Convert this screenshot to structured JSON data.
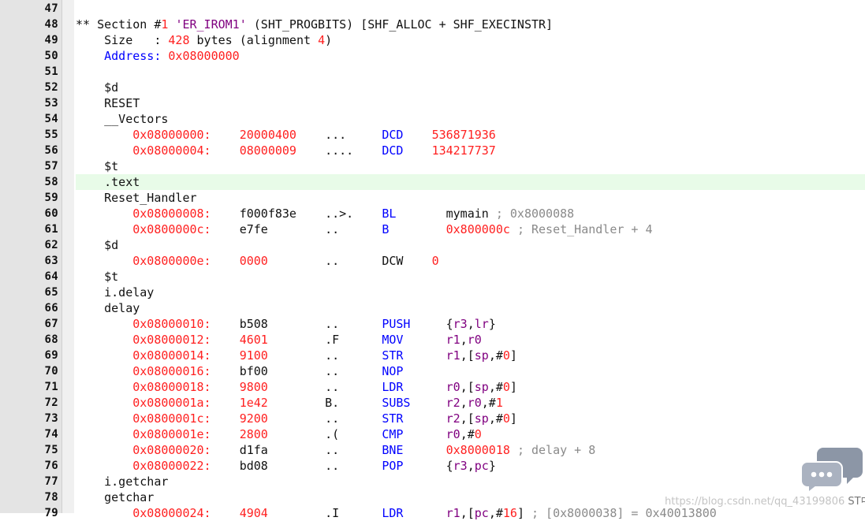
{
  "editor": {
    "lines": [
      {
        "n": "47",
        "t": [
          [
            "",
            "d"
          ]
        ]
      },
      {
        "n": "48",
        "t": [
          [
            "** Section #",
            "d"
          ],
          [
            "1",
            "n"
          ],
          [
            " ",
            "d"
          ],
          [
            "'ER_IROM1'",
            "s"
          ],
          [
            " (SHT_PROGBITS) [SHF_ALLOC + SHF_EXECINSTR]",
            "d"
          ]
        ]
      },
      {
        "n": "49",
        "t": [
          [
            "    Size   : ",
            "d"
          ],
          [
            "428",
            "n"
          ],
          [
            " bytes (alignment ",
            "d"
          ],
          [
            "4",
            "n"
          ],
          [
            ")",
            "d"
          ]
        ]
      },
      {
        "n": "50",
        "t": [
          [
            "    ",
            "d"
          ],
          [
            "Address:",
            "k"
          ],
          [
            " ",
            "d"
          ],
          [
            "0x08000000",
            "n"
          ]
        ]
      },
      {
        "n": "51",
        "t": [
          [
            "",
            "d"
          ]
        ]
      },
      {
        "n": "52",
        "t": [
          [
            "    $d",
            "d"
          ]
        ]
      },
      {
        "n": "53",
        "t": [
          [
            "    RESET",
            "d"
          ]
        ]
      },
      {
        "n": "54",
        "t": [
          [
            "    __Vectors",
            "d"
          ]
        ]
      },
      {
        "n": "55",
        "t": [
          [
            "        ",
            "d"
          ],
          [
            "0x08000000:",
            "n"
          ],
          [
            "    ",
            "d"
          ],
          [
            "20000400",
            "n"
          ],
          [
            "    ...     ",
            "d"
          ],
          [
            "DCD",
            "k"
          ],
          [
            "    ",
            "d"
          ],
          [
            "536871936",
            "n"
          ]
        ]
      },
      {
        "n": "56",
        "t": [
          [
            "        ",
            "d"
          ],
          [
            "0x08000004:",
            "n"
          ],
          [
            "    ",
            "d"
          ],
          [
            "08000009",
            "n"
          ],
          [
            "    ....    ",
            "d"
          ],
          [
            "DCD",
            "k"
          ],
          [
            "    ",
            "d"
          ],
          [
            "134217737",
            "n"
          ]
        ]
      },
      {
        "n": "57",
        "t": [
          [
            "    $t",
            "d"
          ]
        ]
      },
      {
        "n": "58",
        "t": [
          [
            "    .text",
            "d"
          ]
        ],
        "hl": true
      },
      {
        "n": "59",
        "t": [
          [
            "    Reset_Handler",
            "d"
          ]
        ]
      },
      {
        "n": "60",
        "t": [
          [
            "        ",
            "d"
          ],
          [
            "0x08000008:",
            "n"
          ],
          [
            "    f000f83e    ..>.    ",
            "d"
          ],
          [
            "BL",
            "k"
          ],
          [
            "       mymain ",
            "d"
          ],
          [
            "; 0x8000088",
            "g"
          ]
        ]
      },
      {
        "n": "61",
        "t": [
          [
            "        ",
            "d"
          ],
          [
            "0x0800000c:",
            "n"
          ],
          [
            "    e7fe        ..      ",
            "d"
          ],
          [
            "B",
            "k"
          ],
          [
            "        ",
            "d"
          ],
          [
            "0x800000c",
            "n"
          ],
          [
            " ",
            "d"
          ],
          [
            "; Reset_Handler + 4",
            "g"
          ]
        ]
      },
      {
        "n": "62",
        "t": [
          [
            "    $d",
            "d"
          ]
        ]
      },
      {
        "n": "63",
        "t": [
          [
            "        ",
            "d"
          ],
          [
            "0x0800000e:",
            "n"
          ],
          [
            "    ",
            "d"
          ],
          [
            "0000",
            "n"
          ],
          [
            "        ..      DCW    ",
            "d"
          ],
          [
            "0",
            "n"
          ]
        ]
      },
      {
        "n": "64",
        "t": [
          [
            "    $t",
            "d"
          ]
        ]
      },
      {
        "n": "65",
        "t": [
          [
            "    i.delay",
            "d"
          ]
        ]
      },
      {
        "n": "66",
        "t": [
          [
            "    delay",
            "d"
          ]
        ]
      },
      {
        "n": "67",
        "t": [
          [
            "        ",
            "d"
          ],
          [
            "0x08000010:",
            "n"
          ],
          [
            "    b508        ..      ",
            "d"
          ],
          [
            "PUSH",
            "k"
          ],
          [
            "     {",
            "d"
          ],
          [
            "r3",
            "s"
          ],
          [
            ",",
            "d"
          ],
          [
            "lr",
            "s"
          ],
          [
            "}",
            "d"
          ]
        ]
      },
      {
        "n": "68",
        "t": [
          [
            "        ",
            "d"
          ],
          [
            "0x08000012:",
            "n"
          ],
          [
            "    ",
            "d"
          ],
          [
            "4601",
            "n"
          ],
          [
            "        .F      ",
            "d"
          ],
          [
            "MOV",
            "k"
          ],
          [
            "      ",
            "d"
          ],
          [
            "r1",
            "s"
          ],
          [
            ",",
            "d"
          ],
          [
            "r0",
            "s"
          ]
        ]
      },
      {
        "n": "69",
        "t": [
          [
            "        ",
            "d"
          ],
          [
            "0x08000014:",
            "n"
          ],
          [
            "    ",
            "d"
          ],
          [
            "9100",
            "n"
          ],
          [
            "        ..      ",
            "d"
          ],
          [
            "STR",
            "k"
          ],
          [
            "      ",
            "d"
          ],
          [
            "r1",
            "s"
          ],
          [
            ",[",
            "d"
          ],
          [
            "sp",
            "s"
          ],
          [
            ",#",
            "d"
          ],
          [
            "0",
            "n"
          ],
          [
            "]",
            "d"
          ]
        ]
      },
      {
        "n": "70",
        "t": [
          [
            "        ",
            "d"
          ],
          [
            "0x08000016:",
            "n"
          ],
          [
            "    bf00        ..      ",
            "d"
          ],
          [
            "NOP",
            "k"
          ]
        ]
      },
      {
        "n": "71",
        "t": [
          [
            "        ",
            "d"
          ],
          [
            "0x08000018:",
            "n"
          ],
          [
            "    ",
            "d"
          ],
          [
            "9800",
            "n"
          ],
          [
            "        ..      ",
            "d"
          ],
          [
            "LDR",
            "k"
          ],
          [
            "      ",
            "d"
          ],
          [
            "r0",
            "s"
          ],
          [
            ",[",
            "d"
          ],
          [
            "sp",
            "s"
          ],
          [
            ",#",
            "d"
          ],
          [
            "0",
            "n"
          ],
          [
            "]",
            "d"
          ]
        ]
      },
      {
        "n": "72",
        "t": [
          [
            "        ",
            "d"
          ],
          [
            "0x0800001a:",
            "n"
          ],
          [
            "    ",
            "d"
          ],
          [
            "1e42",
            "n"
          ],
          [
            "        B.      ",
            "d"
          ],
          [
            "SUBS",
            "k"
          ],
          [
            "     ",
            "d"
          ],
          [
            "r2",
            "s"
          ],
          [
            ",",
            "d"
          ],
          [
            "r0",
            "s"
          ],
          [
            ",#",
            "d"
          ],
          [
            "1",
            "n"
          ]
        ]
      },
      {
        "n": "73",
        "t": [
          [
            "        ",
            "d"
          ],
          [
            "0x0800001c:",
            "n"
          ],
          [
            "    ",
            "d"
          ],
          [
            "9200",
            "n"
          ],
          [
            "        ..      ",
            "d"
          ],
          [
            "STR",
            "k"
          ],
          [
            "      ",
            "d"
          ],
          [
            "r2",
            "s"
          ],
          [
            ",[",
            "d"
          ],
          [
            "sp",
            "s"
          ],
          [
            ",#",
            "d"
          ],
          [
            "0",
            "n"
          ],
          [
            "]",
            "d"
          ]
        ]
      },
      {
        "n": "74",
        "t": [
          [
            "        ",
            "d"
          ],
          [
            "0x0800001e:",
            "n"
          ],
          [
            "    ",
            "d"
          ],
          [
            "2800",
            "n"
          ],
          [
            "        .(      ",
            "d"
          ],
          [
            "CMP",
            "k"
          ],
          [
            "      ",
            "d"
          ],
          [
            "r0",
            "s"
          ],
          [
            ",#",
            "d"
          ],
          [
            "0",
            "n"
          ]
        ]
      },
      {
        "n": "75",
        "t": [
          [
            "        ",
            "d"
          ],
          [
            "0x08000020:",
            "n"
          ],
          [
            "    d1fa        ..      ",
            "d"
          ],
          [
            "BNE",
            "k"
          ],
          [
            "      ",
            "d"
          ],
          [
            "0x8000018",
            "n"
          ],
          [
            " ",
            "d"
          ],
          [
            "; delay + 8",
            "g"
          ]
        ]
      },
      {
        "n": "76",
        "t": [
          [
            "        ",
            "d"
          ],
          [
            "0x08000022:",
            "n"
          ],
          [
            "    bd08        ..      ",
            "d"
          ],
          [
            "POP",
            "k"
          ],
          [
            "      {",
            "d"
          ],
          [
            "r3",
            "s"
          ],
          [
            ",",
            "d"
          ],
          [
            "pc",
            "s"
          ],
          [
            "}",
            "d"
          ]
        ]
      },
      {
        "n": "77",
        "t": [
          [
            "    i.getchar",
            "d"
          ]
        ]
      },
      {
        "n": "78",
        "t": [
          [
            "    getchar",
            "d"
          ]
        ]
      },
      {
        "n": "79",
        "t": [
          [
            "        ",
            "d"
          ],
          [
            "0x08000024:",
            "n"
          ],
          [
            "    ",
            "d"
          ],
          [
            "4904",
            "n"
          ],
          [
            "        .I      ",
            "d"
          ],
          [
            "LDR",
            "k"
          ],
          [
            "      ",
            "d"
          ],
          [
            "r1",
            "s"
          ],
          [
            ",[",
            "d"
          ],
          [
            "pc",
            "s"
          ],
          [
            ",#",
            "d"
          ],
          [
            "16",
            "n"
          ],
          [
            "] ",
            "d"
          ],
          [
            "; [0x8000038] = 0x40013800",
            "g"
          ]
        ]
      }
    ]
  },
  "watermark": {
    "url": "https://blog.csdn.net/qq_43199806",
    "brand": "ST中文论坛",
    "icon": "chat-bubbles-icon"
  }
}
